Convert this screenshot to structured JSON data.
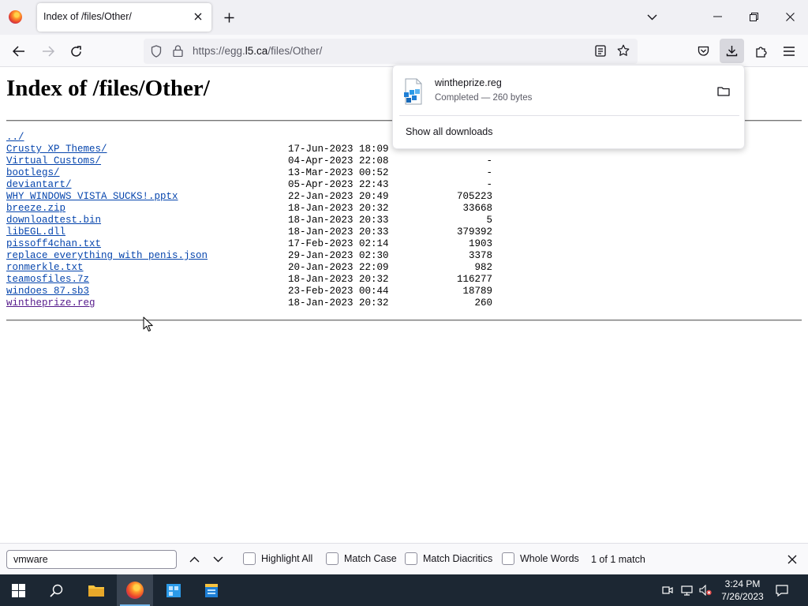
{
  "browser": {
    "tab_title": "Index of /files/Other/",
    "url_prefix": "https://egg.",
    "url_domain": "l5.ca",
    "url_path": "/files/Other/"
  },
  "page": {
    "heading": "Index of /files/Other/",
    "parent_link": "../",
    "entries": [
      {
        "name": "Crusty XP Themes/",
        "date": "17-Jun-2023 18:09",
        "size": "-"
      },
      {
        "name": "Virtual Customs/",
        "date": "04-Apr-2023 22:08",
        "size": "-"
      },
      {
        "name": "bootlegs/",
        "date": "13-Mar-2023 00:52",
        "size": "-"
      },
      {
        "name": "deviantart/",
        "date": "05-Apr-2023 22:43",
        "size": "-"
      },
      {
        "name": "WHY WINDOWS VISTA SUCKS!.pptx",
        "date": "22-Jan-2023 20:49",
        "size": "705223"
      },
      {
        "name": "breeze.zip",
        "date": "18-Jan-2023 20:32",
        "size": "33668"
      },
      {
        "name": "downloadtest.bin",
        "date": "18-Jan-2023 20:33",
        "size": "5"
      },
      {
        "name": "libEGL.dll",
        "date": "18-Jan-2023 20:33",
        "size": "379392"
      },
      {
        "name": "pissoff4chan.txt",
        "date": "17-Feb-2023 02:14",
        "size": "1903"
      },
      {
        "name": "replace everything with penis.json",
        "date": "29-Jan-2023 02:30",
        "size": "3378"
      },
      {
        "name": "ronmerkle.txt",
        "date": "20-Jan-2023 22:09",
        "size": "982"
      },
      {
        "name": "teamosfiles.7z",
        "date": "18-Jan-2023 20:32",
        "size": "116277"
      },
      {
        "name": "windoes 87.sb3",
        "date": "23-Feb-2023 00:44",
        "size": "18789"
      },
      {
        "name": "wintheprize.reg",
        "date": "18-Jan-2023 20:32",
        "size": "260"
      }
    ]
  },
  "downloads": {
    "file_name": "wintheprize.reg",
    "status": "Completed — 260 bytes",
    "show_all": "Show all downloads"
  },
  "findbar": {
    "query": "vmware",
    "highlight_all": "Highlight All",
    "match_case": "Match Case",
    "match_diacritics": "Match Diacritics",
    "whole_words": "Whole Words",
    "result": "1 of 1 match"
  },
  "taskbar": {
    "time": "3:24 PM",
    "date": "7/26/2023"
  }
}
